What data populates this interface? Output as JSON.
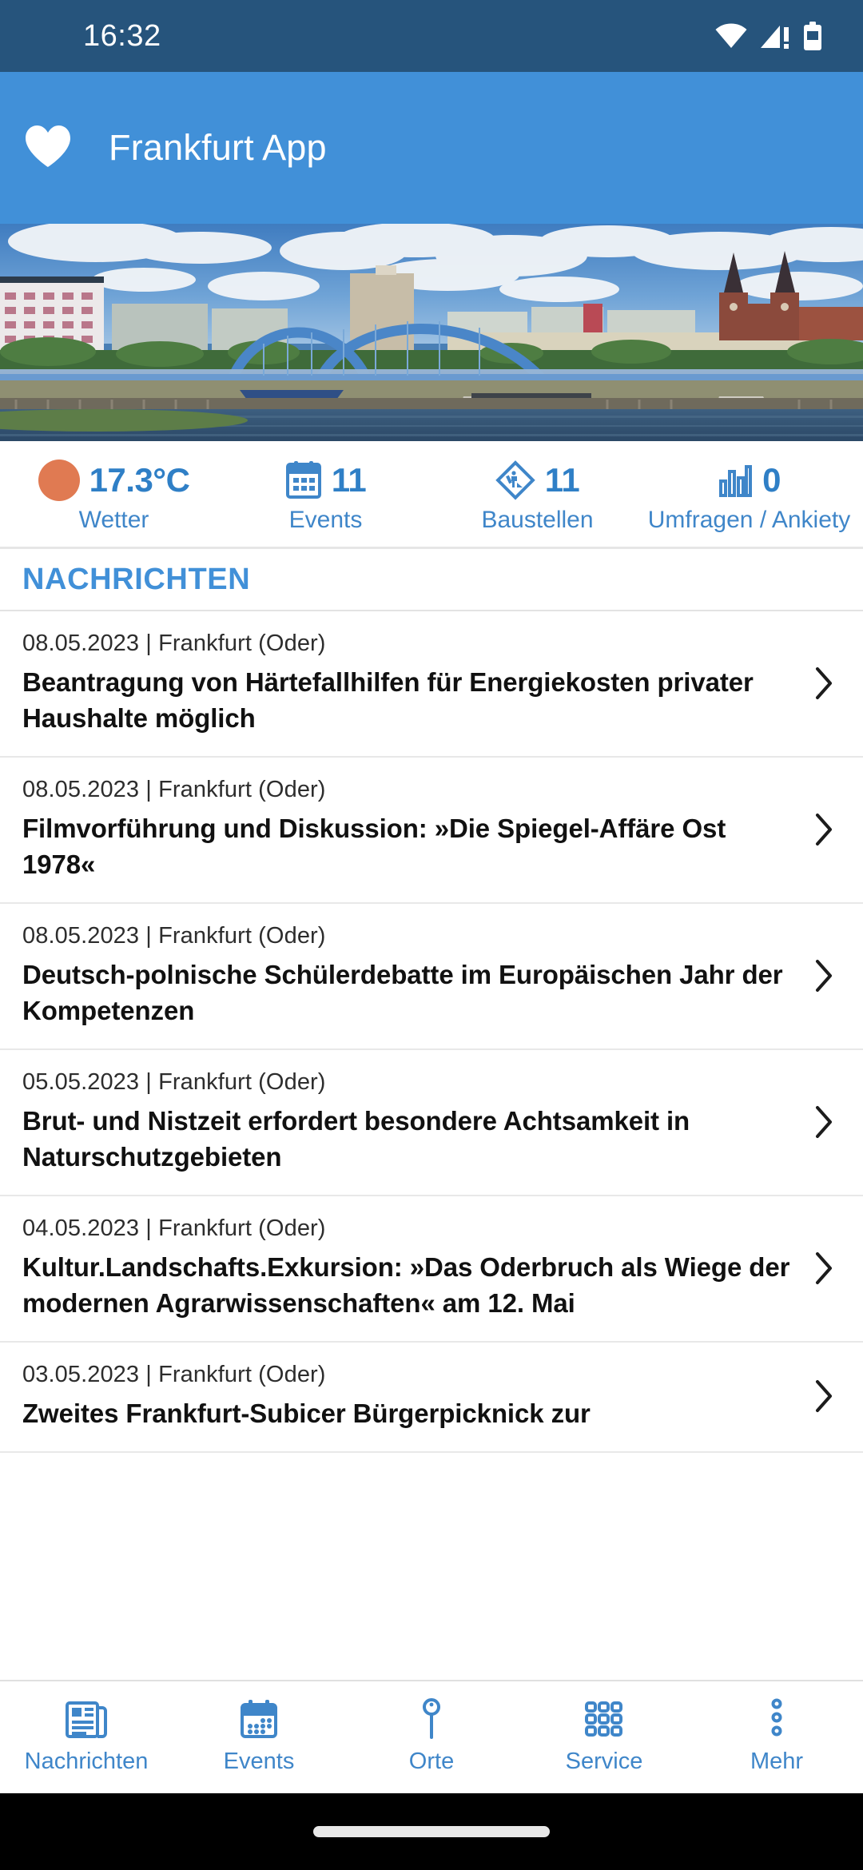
{
  "status_bar": {
    "time": "16:32",
    "icons": [
      "wifi-icon",
      "signal-no-sim-icon",
      "battery-icon"
    ],
    "background_color": "#26547c"
  },
  "app_bar": {
    "favorite_icon": "heart-icon",
    "title": "Frankfurt App",
    "background_color": "#4190d8"
  },
  "hero": {
    "alt": "Frankfurt (Oder) Stadtbruecke ueber die Oder"
  },
  "stats": [
    {
      "icon": "sun-icon",
      "value": "17.3°C",
      "label": "Wetter"
    },
    {
      "icon": "calendar-icon",
      "value": "11",
      "label": "Events"
    },
    {
      "icon": "roadworks-icon",
      "value": "11",
      "label": "Baustellen"
    },
    {
      "icon": "bar-chart-icon",
      "value": "0",
      "label": "Umfragen / Ankiety"
    }
  ],
  "section": {
    "title": "NACHRICHTEN"
  },
  "news": [
    {
      "meta": "08.05.2023 | Frankfurt (Oder)",
      "title": "Beantragung von Härtefallhilfen für Energiekosten privater Haushalte möglich"
    },
    {
      "meta": "08.05.2023 | Frankfurt (Oder)",
      "title": "Filmvorführung und Diskussion: »Die Spiegel-Affäre Ost 1978«"
    },
    {
      "meta": "08.05.2023 | Frankfurt (Oder)",
      "title": "Deutsch-polnische Schülerdebatte im Europäischen Jahr der Kompetenzen"
    },
    {
      "meta": "05.05.2023 | Frankfurt (Oder)",
      "title": "Brut- und Nistzeit erfordert besondere Achtsamkeit in Naturschutzgebieten"
    },
    {
      "meta": "04.05.2023 | Frankfurt (Oder)",
      "title": "Kultur.Landschafts.Exkursion: »Das Oderbruch als Wiege der modernen Agrarwissenschaften« am 12. Mai"
    },
    {
      "meta": "03.05.2023 | Frankfurt (Oder)",
      "title": "Zweites Frankfurt-Subicer Bürgerpicknick zur"
    }
  ],
  "bottom_nav": [
    {
      "icon": "newspaper-icon",
      "label": "Nachrichten"
    },
    {
      "icon": "calendar-icon",
      "label": "Events"
    },
    {
      "icon": "map-pin-icon",
      "label": "Orte"
    },
    {
      "icon": "grid-icon",
      "label": "Service"
    },
    {
      "icon": "more-dots-icon",
      "label": "Mehr"
    }
  ],
  "colors": {
    "accent_blue": "#4190d8",
    "stat_blue": "#2f7fc6",
    "status_bar": "#26547c",
    "weather_orange": "#e07a52",
    "text_dark": "#111111"
  }
}
